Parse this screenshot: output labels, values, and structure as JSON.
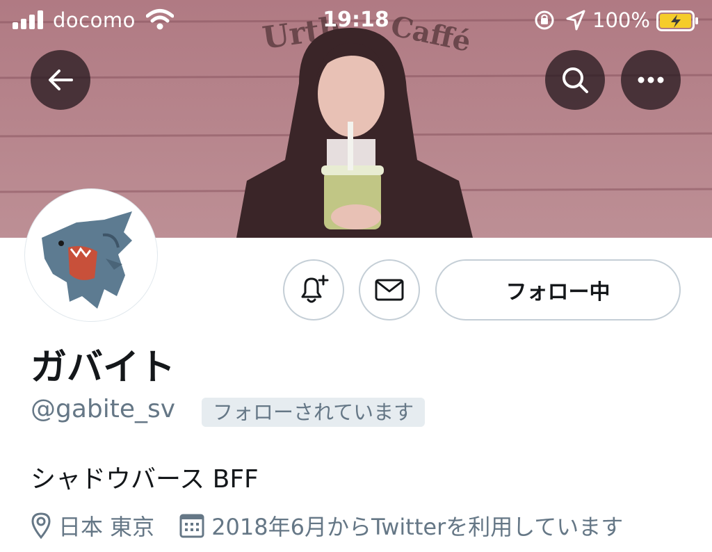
{
  "status_bar": {
    "carrier": "docomo",
    "time": "19:18",
    "battery": "100%",
    "icons": [
      "signal-icon",
      "wifi-icon",
      "orientation-lock-icon",
      "location-icon",
      "battery-charging-icon"
    ]
  },
  "header": {
    "back_icon": "arrow-left-icon",
    "search_icon": "search-icon",
    "more_icon": "more-dots-icon"
  },
  "profile": {
    "display_name": "ガバイト",
    "handle": "@gabite_sv",
    "follows_you": "フォローされています",
    "bio": "シャドウバース BFF",
    "location": "日本 東京",
    "joined": "2018年6月からTwitterを利用しています",
    "follow_button": "フォロー中"
  },
  "colors": {
    "accent_text": "#14171a",
    "secondary_text": "#657786",
    "badge_bg": "#e6ecf0",
    "button_border": "#c4ced6"
  }
}
